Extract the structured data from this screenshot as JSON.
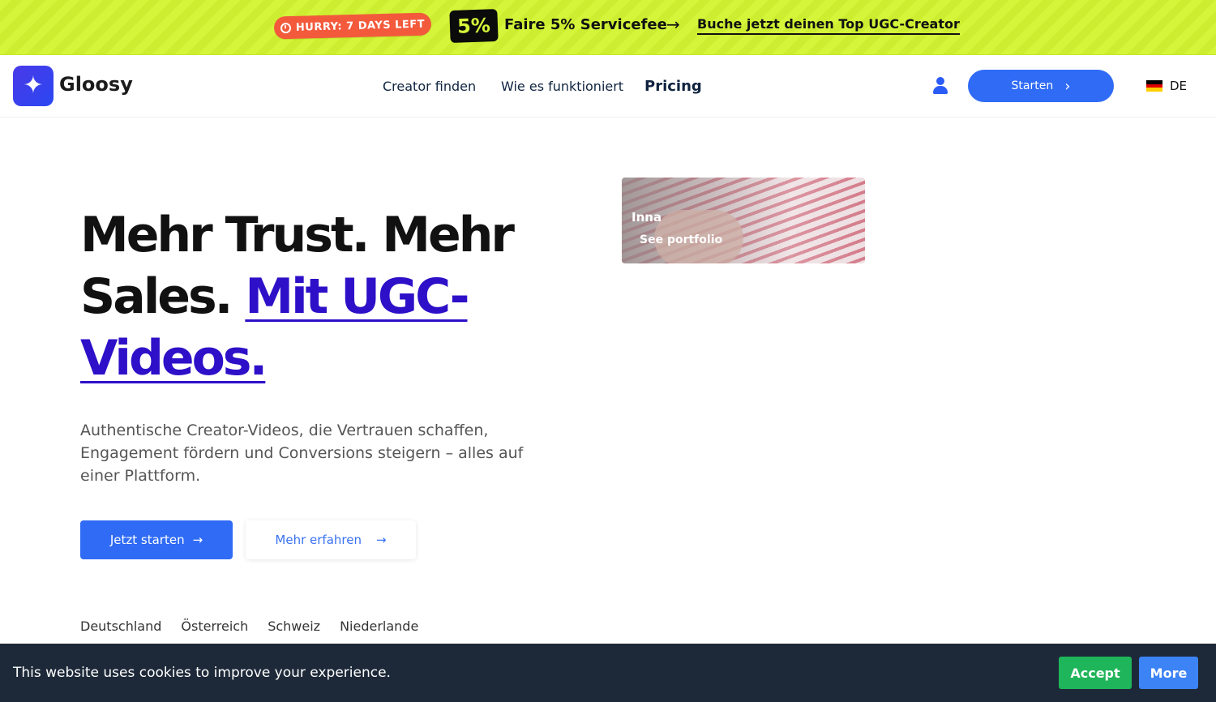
{
  "promo": {
    "hurry_label": "HURRY: 7 DAYS LEFT",
    "percent": "5%",
    "fee_text": "Faire 5% Servicefee",
    "arrow": "→",
    "book_link": "Buche jetzt deinen Top UGC-Creator",
    "colors": {
      "banner": "#d4f53a",
      "hurry": "#f35a3c"
    }
  },
  "nav": {
    "brand": "Gloosy",
    "links": [
      "Creator finden",
      "Wie es funktioniert",
      "Pricing"
    ],
    "start_label": "Starten",
    "start_chevron": "›",
    "lang": "DE",
    "accent": "#2f6bf5"
  },
  "hero": {
    "title_part1": "Mehr Trust. Mehr Sales. ",
    "title_accent": "Mit UGC-Videos.",
    "subtitle": "Authentische Creator-Videos, die Vertrauen schaffen, Engagement fördern und Conversions steigern – alles auf einer Plattform.",
    "primary_cta": "Jetzt starten",
    "secondary_cta": "Mehr erfahren",
    "cta_arrow": "→",
    "countries": [
      "Deutschland",
      "Österreich",
      "Schweiz",
      "Niederlande"
    ]
  },
  "creator_card": {
    "name": "Inna",
    "link": "See portfolio"
  },
  "cookie": {
    "text": "This website uses cookies to improve your experience.",
    "accept": "Accept",
    "more": "More"
  }
}
